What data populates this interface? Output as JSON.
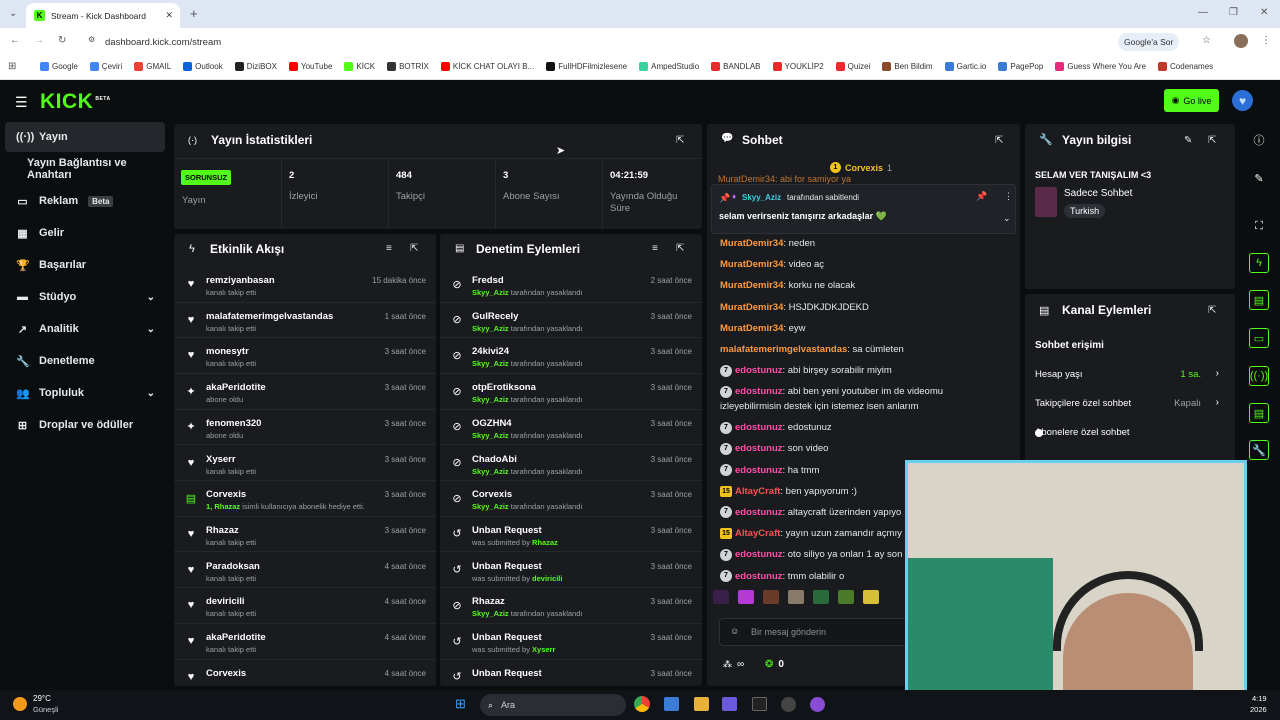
{
  "browser": {
    "tab_title": "Stream - Kick Dashboard",
    "url": "dashboard.kick.com/stream",
    "google_ask": "Google'a Sor",
    "bookmarks": [
      {
        "label": "Google",
        "color": "#4285f4"
      },
      {
        "label": "Çeviri",
        "color": "#4285f4"
      },
      {
        "label": "GMAIL",
        "color": "#ea4335"
      },
      {
        "label": "Outlook",
        "color": "#0a64d8"
      },
      {
        "label": "DiziBOX",
        "color": "#222222"
      },
      {
        "label": "YouTube",
        "color": "#ff0000"
      },
      {
        "label": "KİCK",
        "color": "#53fc18"
      },
      {
        "label": "BOTRİX",
        "color": "#333333"
      },
      {
        "label": "KİCK CHAT OLAYI B...",
        "color": "#ff0000"
      },
      {
        "label": "FullHDFilmizlesene",
        "color": "#111111"
      },
      {
        "label": "AmpedStudio",
        "color": "#3ad0a0"
      },
      {
        "label": "BANDLAB",
        "color": "#e52b2b"
      },
      {
        "label": "YOUKLİP2",
        "color": "#e52b2b"
      },
      {
        "label": "Quizei",
        "color": "#e52b2b"
      },
      {
        "label": "Ben Bildim",
        "color": "#8a4b2a"
      },
      {
        "label": "Gartic.io",
        "color": "#3a7bd5"
      },
      {
        "label": "PagePop",
        "color": "#3a7bd5"
      },
      {
        "label": "Guess Where You Are",
        "color": "#e52b7a"
      },
      {
        "label": "Codenames",
        "color": "#c0392b"
      }
    ]
  },
  "header": {
    "logo": "KICK",
    "logo_sup": "BETA",
    "go_live": "Go live"
  },
  "sidebar": {
    "items": [
      {
        "label": "Yayın",
        "icon": "broadcast-icon",
        "glyph": "((·))",
        "chevron": ""
      },
      {
        "label": "Yayın Bağlantısı ve Anahtarı",
        "icon": "",
        "glyph": "",
        "chevron": ""
      },
      {
        "label": "Reklam",
        "icon": "ad-icon",
        "glyph": "▭",
        "chevron": "",
        "badge": "Beta"
      },
      {
        "label": "Gelir",
        "icon": "revenue-icon",
        "glyph": "▦",
        "chevron": ""
      },
      {
        "label": "Başarılar",
        "icon": "trophy-icon",
        "glyph": "🏆",
        "chevron": ""
      },
      {
        "label": "Stüdyo",
        "icon": "studio-icon",
        "glyph": "▬",
        "chevron": "⌄"
      },
      {
        "label": "Analitik",
        "icon": "analytics-icon",
        "glyph": "↗",
        "chevron": "⌄"
      },
      {
        "label": "Denetleme",
        "icon": "wrench-icon",
        "glyph": "🔧",
        "chevron": ""
      },
      {
        "label": "Topluluk",
        "icon": "community-icon",
        "glyph": "👥",
        "chevron": "⌄"
      },
      {
        "label": "Droplar ve ödüller",
        "icon": "drops-icon",
        "glyph": "⊞",
        "chevron": ""
      }
    ]
  },
  "stats": {
    "title": "Yayın İstatistikleri",
    "status_badge": "SORUNSUZ",
    "status_label": "Yayın",
    "cells": [
      {
        "value": "2",
        "label": "İzleyici"
      },
      {
        "value": "484",
        "label": "Takipçi"
      },
      {
        "value": "3",
        "label": "Abone Sayısı"
      },
      {
        "value": "04:21:59",
        "label": "Yayında Olduğu Süre"
      }
    ]
  },
  "activity": {
    "title": "Etkinlik Akışı",
    "rows": [
      {
        "name": "remziyanbasan",
        "sub": "kanalı takip etti",
        "hl": "",
        "time": "15 dakika önce",
        "icon": "heart-icon",
        "glyph": "♥"
      },
      {
        "name": "malafatemerimgelvastandas",
        "sub": "kanalı takip etti",
        "hl": "",
        "time": "1 saat önce",
        "icon": "heart-icon",
        "glyph": "♥"
      },
      {
        "name": "monesytr",
        "sub": "kanalı takip etti",
        "hl": "",
        "time": "3 saat önce",
        "icon": "heart-icon",
        "glyph": "♥"
      },
      {
        "name": "akaPeridotite",
        "sub": "abone oldu",
        "hl": "",
        "time": "3 saat önce",
        "icon": "sparkle-icon",
        "glyph": "✦"
      },
      {
        "name": "fenomen320",
        "sub": "abone oldu",
        "hl": "",
        "time": "3 saat önce",
        "icon": "sparkle-icon",
        "glyph": "✦"
      },
      {
        "name": "Xyserr",
        "sub": "kanalı takip etti",
        "hl": "",
        "time": "3 saat önce",
        "icon": "heart-icon",
        "glyph": "♥"
      },
      {
        "name": "Corvexis",
        "sub": " isimli kullanıcıya abonelik hediye etti.",
        "hl": "1, Rhazaz",
        "time": "3 saat önce",
        "icon": "gift-icon",
        "glyph": "▤"
      },
      {
        "name": "Rhazaz",
        "sub": "kanalı takip etti",
        "hl": "",
        "time": "3 saat önce",
        "icon": "heart-icon",
        "glyph": "♥"
      },
      {
        "name": "Paradoksan",
        "sub": "kanalı takip etti",
        "hl": "",
        "time": "4 saat önce",
        "icon": "heart-icon",
        "glyph": "♥"
      },
      {
        "name": "deviricili",
        "sub": "kanalı takip etti",
        "hl": "",
        "time": "4 saat önce",
        "icon": "heart-icon",
        "glyph": "♥"
      },
      {
        "name": "akaPeridotite",
        "sub": "kanalı takip etti",
        "hl": "",
        "time": "4 saat önce",
        "icon": "heart-icon",
        "glyph": "♥"
      },
      {
        "name": "Corvexis",
        "sub": "",
        "hl": "",
        "time": "4 saat önce",
        "icon": "heart-icon",
        "glyph": "♥"
      }
    ]
  },
  "moderation": {
    "title": "Denetim Eylemleri",
    "rows": [
      {
        "name": "Fredsd",
        "hl": "Skyy_Aziz",
        "sub": " tarafından yasaklandı",
        "time": "2 saat önce",
        "icon": "ban-icon",
        "glyph": "⊘"
      },
      {
        "name": "GulRecely",
        "hl": "Skyy_Aziz",
        "sub": " tarafından yasaklandı",
        "time": "3 saat önce",
        "icon": "ban-icon",
        "glyph": "⊘"
      },
      {
        "name": "24kivi24",
        "hl": "Skyy_Aziz",
        "sub": " tarafından yasaklandı",
        "time": "3 saat önce",
        "icon": "ban-icon",
        "glyph": "⊘"
      },
      {
        "name": "otpErotiksona",
        "hl": "Skyy_Aziz",
        "sub": " tarafından yasaklandı",
        "time": "3 saat önce",
        "icon": "ban-icon",
        "glyph": "⊘"
      },
      {
        "name": "OGZHN4",
        "hl": "Skyy_Aziz",
        "sub": " tarafından yasaklandı",
        "time": "3 saat önce",
        "icon": "ban-icon",
        "glyph": "⊘"
      },
      {
        "name": "ChadoAbi",
        "hl": "Skyy_Aziz",
        "sub": " tarafından yasaklandı",
        "time": "3 saat önce",
        "icon": "ban-icon",
        "glyph": "⊘"
      },
      {
        "name": "Corvexis",
        "hl": "Skyy_Aziz",
        "sub": " tarafından yasaklandı",
        "time": "3 saat önce",
        "icon": "ban-icon",
        "glyph": "⊘"
      },
      {
        "name": "Unban Request",
        "pre": "was submitted by ",
        "hl": "Rhazaz",
        "sub": "",
        "time": "3 saat önce",
        "icon": "undo-icon",
        "glyph": "↺"
      },
      {
        "name": "Unban Request",
        "pre": "was submitted by ",
        "hl": "deviricili",
        "sub": "",
        "time": "3 saat önce",
        "icon": "undo-icon",
        "glyph": "↺"
      },
      {
        "name": "Rhazaz",
        "hl": "Skyy_Aziz",
        "sub": " tarafından yasaklandı",
        "time": "3 saat önce",
        "icon": "ban-icon",
        "glyph": "⊘"
      },
      {
        "name": "Unban Request",
        "pre": "was submitted by ",
        "hl": "Xyserr",
        "sub": "",
        "time": "3 saat önce",
        "icon": "undo-icon",
        "glyph": "↺"
      },
      {
        "name": "Unban Request",
        "pre": "",
        "hl": "",
        "sub": "",
        "time": "3 saat önce",
        "icon": "undo-icon",
        "glyph": "↺"
      }
    ]
  },
  "chat": {
    "title": "Sohbet",
    "top_user": "Corvexis",
    "top_count": "1",
    "cutoff_line": "MuratDemir34: abi for samiyor ya",
    "pinned_user": "Skyy_Aziz",
    "pinned_by": "tarafından sabitlendi",
    "pinned_msg": "selam verirseniz tanışırız arkadaşlar 💚",
    "messages": [
      {
        "user": "MuratDemir34",
        "cls": "u-orange",
        "badge": "",
        "text": ": neden"
      },
      {
        "user": "MuratDemir34",
        "cls": "u-orange",
        "badge": "",
        "text": ": video aç"
      },
      {
        "user": "MuratDemir34",
        "cls": "u-orange",
        "badge": "",
        "text": ": korku ne olacak"
      },
      {
        "user": "MuratDemir34",
        "cls": "u-orange",
        "badge": "",
        "text": ": HSJDKJDKJDEKD"
      },
      {
        "user": "MuratDemir34",
        "cls": "u-orange",
        "badge": "",
        "text": ": eyw"
      },
      {
        "user": "malafatemerimgelvastandas",
        "cls": "u-orange",
        "badge": "",
        "text": ": sa cümleten"
      },
      {
        "user": "edostunuz",
        "cls": "u-pink",
        "badge": "7",
        "text": ": abi birşey sorabilir miyim"
      },
      {
        "user": "edostunuz",
        "cls": "u-pink",
        "badge": "7",
        "text": ": abi ben yeni youtuber im de videomu",
        "wrap": "izleyebilirmisin destek için istemez isen anlarım"
      },
      {
        "user": "edostunuz",
        "cls": "u-pink",
        "badge": "7",
        "text": ": edostunuz"
      },
      {
        "user": "edostunuz",
        "cls": "u-pink",
        "badge": "7",
        "text": ": son video"
      },
      {
        "user": "edostunuz",
        "cls": "u-pink",
        "badge": "7",
        "text": ": ha tmm"
      },
      {
        "user": "AltayCraft",
        "cls": "u-craft",
        "badge": "15",
        "text": ": ben yapıyorum :)"
      },
      {
        "user": "edostunuz",
        "cls": "u-pink",
        "badge": "7",
        "text": ": altaycraft üzerinden yapıyo"
      },
      {
        "user": "AltayCraft",
        "cls": "u-craft",
        "badge": "15",
        "text": ": yayın uzun zamandır açmıy"
      },
      {
        "user": "edostunuz",
        "cls": "u-pink",
        "badge": "7",
        "text": ": oto siliyo ya onları 1 ay son"
      },
      {
        "user": "edostunuz",
        "cls": "u-pink",
        "badge": "7",
        "text": ": tmm olabilir o"
      }
    ],
    "input_placeholder": "Bir mesaj gönderin",
    "points_label": "∞",
    "coins_label": "0"
  },
  "info": {
    "title": "Yayın bilgisi",
    "stream_title": "SELAM VER TANIŞALIM <3",
    "category": "Sadece Sohbet",
    "tag": "Turkish"
  },
  "actions": {
    "title": "Kanal Eylemleri",
    "section": "Sohbet erişimi",
    "rows": [
      {
        "label": "Hesap yaşı",
        "value": "1 sa.",
        "value_color": "#53fc18"
      },
      {
        "label": "Takipçilere özel sohbet",
        "value": "Kapalı",
        "value_color": "#9aa0a6"
      },
      {
        "label": "Abonelere özel sohbet",
        "value": "",
        "value_color": ""
      }
    ]
  },
  "taskbar": {
    "temp": "29°C",
    "weather": "Güneşli",
    "search": "Ara",
    "time": "4:19",
    "date": "2026"
  }
}
